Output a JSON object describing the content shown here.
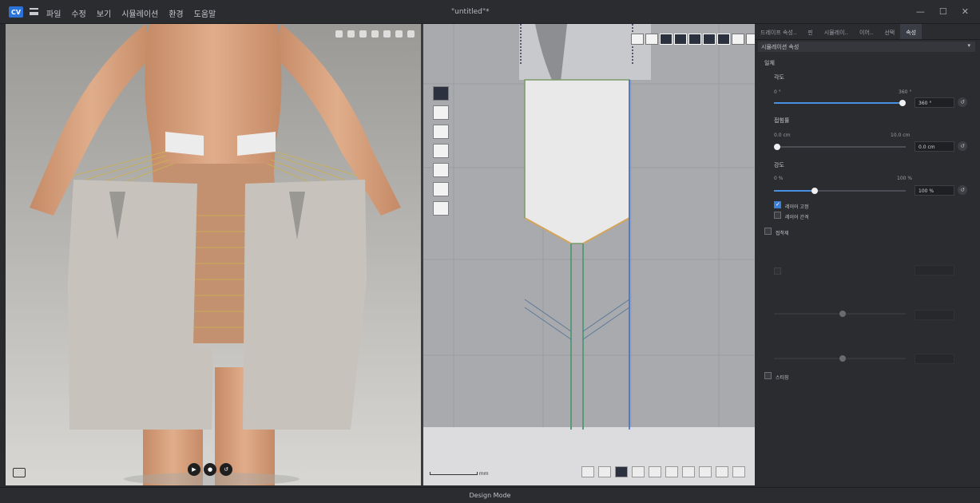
{
  "titlebar": {
    "logo": "CV",
    "menu": [
      "파일",
      "수정",
      "보기",
      "시뮬레이션",
      "환경",
      "도움말"
    ],
    "window_title": "\"untitled\"*",
    "controls": [
      "—",
      "☐",
      "✕"
    ]
  },
  "viewport3d": {
    "icons": [
      "view-icon",
      "light-icon",
      "grid-icon",
      "camera-icon",
      "layer-icon",
      "avatar-icon",
      "settings-icon"
    ],
    "play": [
      "play-icon",
      "record-icon",
      "reset-icon"
    ]
  },
  "pattern2d": {
    "tools": [
      "select-icon",
      "segment-icon",
      "polygon-icon",
      "internal-icon",
      "circle-icon",
      "rectangle-icon",
      "sewing-icon"
    ],
    "top_tools": [
      "transform",
      "arrange",
      "seg",
      "tgl1",
      "tgl2",
      "tgl3",
      "tgl4",
      "tgl5",
      "tgl6",
      "tgl7"
    ],
    "bottom_tools": [
      "t1",
      "t2",
      "t3",
      "t4",
      "t5",
      "t6",
      "t7",
      "t8",
      "t9",
      "t10",
      "t11"
    ],
    "scale_label": "mm"
  },
  "panel": {
    "tabs": [
      "드레이프 속성..",
      "핀",
      "시뮬레이..",
      "이어..",
      "선택",
      "속성"
    ],
    "active_tab_index": 5,
    "subhead": "시뮬레이션 속성",
    "section": "일체",
    "group1": {
      "title": "각도",
      "min": "0 °",
      "max": "360 °",
      "value": "360 °",
      "fraction": 1.0
    },
    "group2": {
      "title": "접힘률",
      "min": "0.0 cm",
      "max": "10.0 cm",
      "value": "0.0 cm",
      "fraction": 0.0
    },
    "group3": {
      "title": "강도",
      "min": "0 %",
      "max": "100 %",
      "value": "100 %",
      "fraction": 0.3
    },
    "checks": [
      {
        "label": "레이어 고정",
        "on": true
      },
      {
        "label": "레이어 간격",
        "on": false
      }
    ],
    "toggle1": "접착제",
    "toggle2": "스티칭"
  },
  "status": "Design Mode",
  "colors": {
    "accent": "#4a90e2",
    "bg": "#2b2c30",
    "canvas2d": "#a9aaad"
  }
}
